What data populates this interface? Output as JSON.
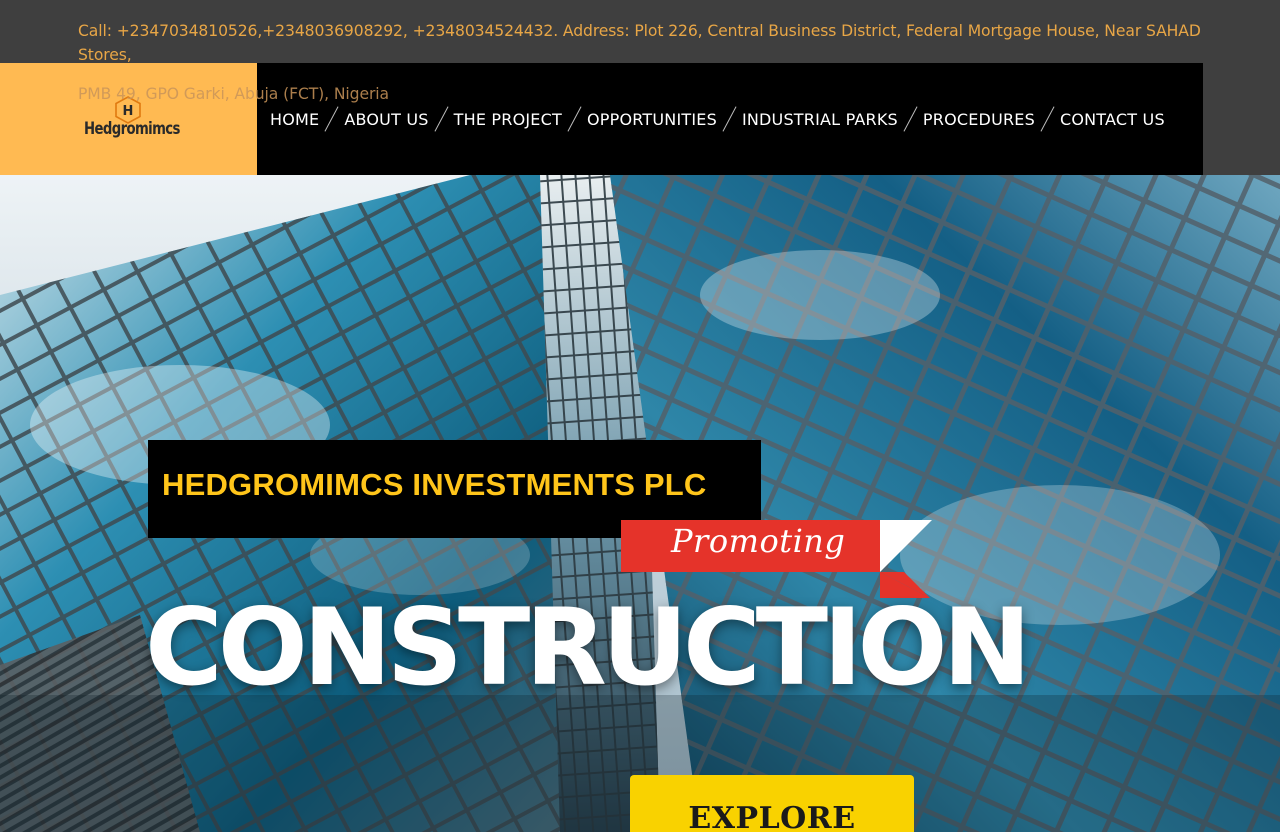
{
  "topbar": {
    "contact_line1": "Call: +2347034810526,+2348036908292, +2348034524432. Address: Plot 226, Central Business District, Federal Mortgage House, Near SAHAD Stores,",
    "contact_line2": "PMB 49, GPO Garki, Abuja (FCT), Nigeria"
  },
  "logo": {
    "letter": "H",
    "word": "Hedgromimcs"
  },
  "nav": {
    "items": [
      {
        "label": "HOME"
      },
      {
        "label": "ABOUT US"
      },
      {
        "label": "THE PROJECT"
      },
      {
        "label": "OPPORTUNITIES"
      },
      {
        "label": "INDUSTRIAL PARKS"
      },
      {
        "label": "PROCEDURES"
      },
      {
        "label": "CONTACT US"
      }
    ]
  },
  "hero": {
    "company_title": "HEDGROMIMCS INVESTMENTS PLC",
    "promo_label": "Promoting",
    "headline": "CONSTRUCTION",
    "cta_label": "EXPLORE"
  },
  "colors": {
    "topbar_bg": "#3f3f3f",
    "topbar_text": "#e8a646",
    "logo_bg": "#ffba52",
    "nav_bg": "#000000",
    "title_text": "#ffc51a",
    "ribbon": "#e5332a",
    "cta_bg": "#f9d200"
  }
}
